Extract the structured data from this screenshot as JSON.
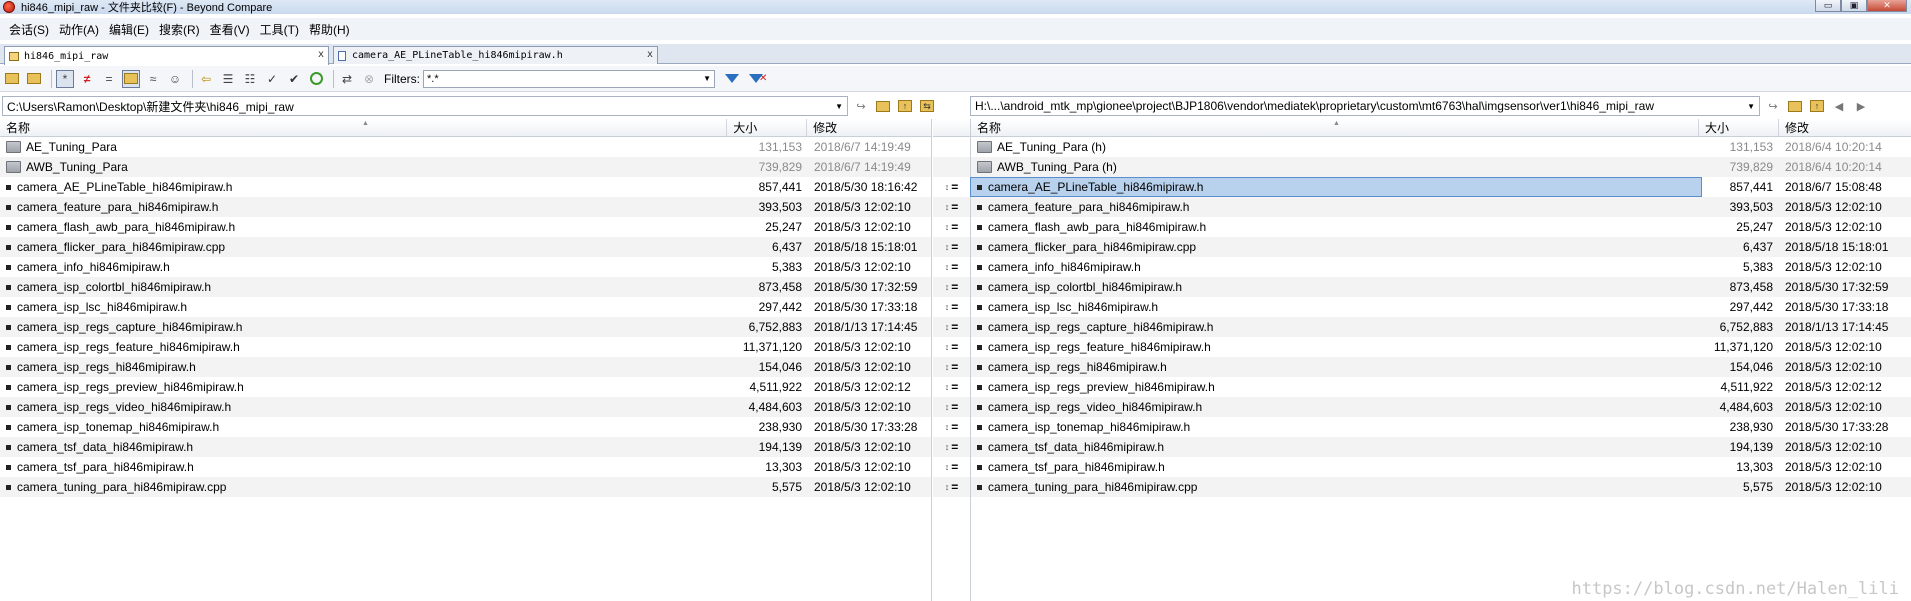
{
  "window": {
    "title": "hi846_mipi_raw - 文件夹比较(F) - Beyond Compare",
    "buttons": [
      "▭",
      "▣",
      "✕"
    ]
  },
  "menu": [
    "会话(S)",
    "动作(A)",
    "编辑(E)",
    "搜索(R)",
    "查看(V)",
    "工具(T)",
    "帮助(H)"
  ],
  "tabs": [
    {
      "label": "hi846_mipi_raw",
      "close": "x",
      "active": true
    },
    {
      "label": "camera_AE_PLineTable_hi846mipiraw.h",
      "close": "x",
      "active": false
    }
  ],
  "toolbar": {
    "filters_label": "Filters:",
    "filters_value": "*.*",
    "glyphs": {
      "star": "*",
      "neq": "≠",
      "eq": "=",
      "approx": "≈"
    }
  },
  "left_pane": {
    "path": "C:\\Users\\Ramon\\Desktop\\新建文件夹\\hi846_mipi_raw",
    "headers": {
      "name": "名称",
      "size": "大小",
      "modified": "修改"
    },
    "rows": [
      {
        "type": "folder",
        "name": "AE_Tuning_Para",
        "size": "131,153",
        "date": "2018/6/7 14:19:49"
      },
      {
        "type": "folder",
        "name": "AWB_Tuning_Para",
        "size": "739,829",
        "date": "2018/6/7 14:19:49"
      },
      {
        "type": "file",
        "name": "camera_AE_PLineTable_hi846mipiraw.h",
        "size": "857,441",
        "date": "2018/5/30 18:16:42"
      },
      {
        "type": "file",
        "name": "camera_feature_para_hi846mipiraw.h",
        "size": "393,503",
        "date": "2018/5/3 12:02:10"
      },
      {
        "type": "file",
        "name": "camera_flash_awb_para_hi846mipiraw.h",
        "size": "25,247",
        "date": "2018/5/3 12:02:10"
      },
      {
        "type": "file",
        "name": "camera_flicker_para_hi846mipiraw.cpp",
        "size": "6,437",
        "date": "2018/5/18 15:18:01"
      },
      {
        "type": "file",
        "name": "camera_info_hi846mipiraw.h",
        "size": "5,383",
        "date": "2018/5/3 12:02:10"
      },
      {
        "type": "file",
        "name": "camera_isp_colortbl_hi846mipiraw.h",
        "size": "873,458",
        "date": "2018/5/30 17:32:59"
      },
      {
        "type": "file",
        "name": "camera_isp_lsc_hi846mipiraw.h",
        "size": "297,442",
        "date": "2018/5/30 17:33:18"
      },
      {
        "type": "file",
        "name": "camera_isp_regs_capture_hi846mipiraw.h",
        "size": "6,752,883",
        "date": "2018/1/13 17:14:45"
      },
      {
        "type": "file",
        "name": "camera_isp_regs_feature_hi846mipiraw.h",
        "size": "11,371,120",
        "date": "2018/5/3 12:02:10"
      },
      {
        "type": "file",
        "name": "camera_isp_regs_hi846mipiraw.h",
        "size": "154,046",
        "date": "2018/5/3 12:02:10"
      },
      {
        "type": "file",
        "name": "camera_isp_regs_preview_hi846mipiraw.h",
        "size": "4,511,922",
        "date": "2018/5/3 12:02:12"
      },
      {
        "type": "file",
        "name": "camera_isp_regs_video_hi846mipiraw.h",
        "size": "4,484,603",
        "date": "2018/5/3 12:02:10"
      },
      {
        "type": "file",
        "name": "camera_isp_tonemap_hi846mipiraw.h",
        "size": "238,930",
        "date": "2018/5/30 17:33:28"
      },
      {
        "type": "file",
        "name": "camera_tsf_data_hi846mipiraw.h",
        "size": "194,139",
        "date": "2018/5/3 12:02:10"
      },
      {
        "type": "file",
        "name": "camera_tsf_para_hi846mipiraw.h",
        "size": "13,303",
        "date": "2018/5/3 12:02:10"
      },
      {
        "type": "file",
        "name": "camera_tuning_para_hi846mipiraw.cpp",
        "size": "5,575",
        "date": "2018/5/3 12:02:10"
      }
    ]
  },
  "right_pane": {
    "path": "H:\\...\\android_mtk_mp\\gionee\\project\\BJP1806\\vendor\\mediatek\\proprietary\\custom\\mt6763\\hal\\imgsensor\\ver1\\hi846_mipi_raw",
    "headers": {
      "name": "名称",
      "size": "大小",
      "modified": "修改"
    },
    "rows": [
      {
        "type": "folder",
        "name": "AE_Tuning_Para (h)",
        "size": "131,153",
        "date": "2018/6/4 10:20:14"
      },
      {
        "type": "folder",
        "name": "AWB_Tuning_Para (h)",
        "size": "739,829",
        "date": "2018/6/4 10:20:14"
      },
      {
        "type": "file",
        "name": "camera_AE_PLineTable_hi846mipiraw.h",
        "size": "857,441",
        "date": "2018/6/7 15:08:48",
        "selected": true
      },
      {
        "type": "file",
        "name": "camera_feature_para_hi846mipiraw.h",
        "size": "393,503",
        "date": "2018/5/3 12:02:10"
      },
      {
        "type": "file",
        "name": "camera_flash_awb_para_hi846mipiraw.h",
        "size": "25,247",
        "date": "2018/5/3 12:02:10"
      },
      {
        "type": "file",
        "name": "camera_flicker_para_hi846mipiraw.cpp",
        "size": "6,437",
        "date": "2018/5/18 15:18:01"
      },
      {
        "type": "file",
        "name": "camera_info_hi846mipiraw.h",
        "size": "5,383",
        "date": "2018/5/3 12:02:10"
      },
      {
        "type": "file",
        "name": "camera_isp_colortbl_hi846mipiraw.h",
        "size": "873,458",
        "date": "2018/5/30 17:32:59"
      },
      {
        "type": "file",
        "name": "camera_isp_lsc_hi846mipiraw.h",
        "size": "297,442",
        "date": "2018/5/30 17:33:18"
      },
      {
        "type": "file",
        "name": "camera_isp_regs_capture_hi846mipiraw.h",
        "size": "6,752,883",
        "date": "2018/1/13 17:14:45"
      },
      {
        "type": "file",
        "name": "camera_isp_regs_feature_hi846mipiraw.h",
        "size": "11,371,120",
        "date": "2018/5/3 12:02:10"
      },
      {
        "type": "file",
        "name": "camera_isp_regs_hi846mipiraw.h",
        "size": "154,046",
        "date": "2018/5/3 12:02:10"
      },
      {
        "type": "file",
        "name": "camera_isp_regs_preview_hi846mipiraw.h",
        "size": "4,511,922",
        "date": "2018/5/3 12:02:12"
      },
      {
        "type": "file",
        "name": "camera_isp_regs_video_hi846mipiraw.h",
        "size": "4,484,603",
        "date": "2018/5/3 12:02:10"
      },
      {
        "type": "file",
        "name": "camera_isp_tonemap_hi846mipiraw.h",
        "size": "238,930",
        "date": "2018/5/30 17:33:28"
      },
      {
        "type": "file",
        "name": "camera_tsf_data_hi846mipiraw.h",
        "size": "194,139",
        "date": "2018/5/3 12:02:10"
      },
      {
        "type": "file",
        "name": "camera_tsf_para_hi846mipiraw.h",
        "size": "13,303",
        "date": "2018/5/3 12:02:10"
      },
      {
        "type": "file",
        "name": "camera_tuning_para_hi846mipiraw.cpp",
        "size": "5,575",
        "date": "2018/5/3 12:02:10"
      }
    ]
  },
  "gutter": {
    "marker": "↕",
    "equal": "="
  },
  "watermark": "https://blog.csdn.net/Halen_lili",
  "colors": {
    "selection": "#b8d2ee",
    "alt_row": "#f3f3f3",
    "folder_meta": "#8a8a8a"
  }
}
